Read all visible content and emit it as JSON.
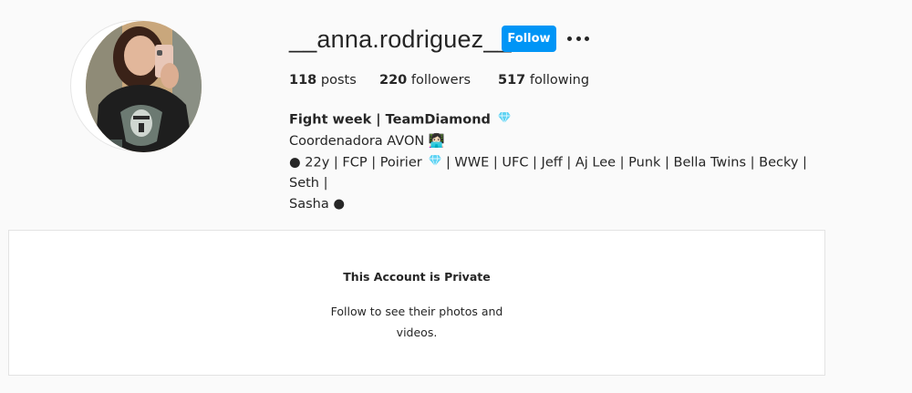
{
  "profile": {
    "username": "__anna.rodriguez__",
    "follow_label": "Follow",
    "more_icon": "more-options-icon",
    "avatar_icon": "profile-photo"
  },
  "stats": {
    "posts_count": "118",
    "posts_label": "posts",
    "followers_count": "220",
    "followers_label": "followers",
    "following_count": "517",
    "following_label": "following"
  },
  "bio": {
    "name": "Fight week | TeamDiamond",
    "line1": "Coordenadora AVON 👩🏻‍💻",
    "line2_prefix": "● 22y | FCP | Poirier",
    "line2_suffix": "| WWE | UFC | Jeff | Aj Lee | Punk | Bella Twins | Becky | Seth |",
    "line3": "Sasha ●",
    "accent_color": "#5fd3f3"
  },
  "private_notice": {
    "title": "This Account is Private",
    "subtitle": "Follow to see their photos and videos."
  },
  "colors": {
    "follow_button": "#0095f6",
    "background": "#fafafa",
    "card": "#ffffff"
  }
}
